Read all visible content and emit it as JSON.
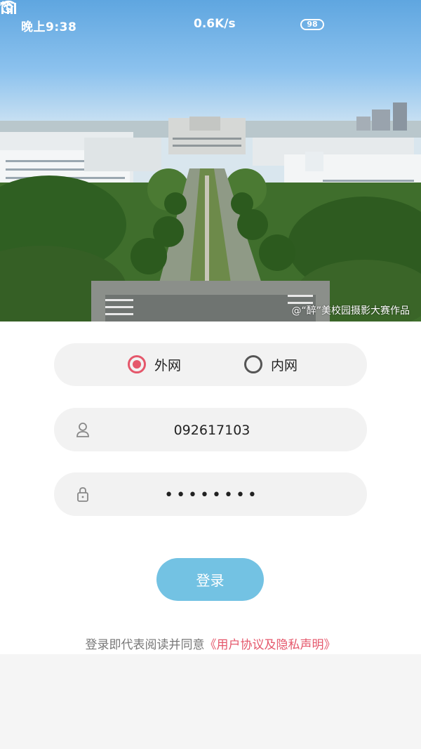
{
  "status_bar": {
    "time": "晚上9:38",
    "network_speed": "0.6K/s",
    "battery": "98"
  },
  "hero": {
    "credit": "@“醉”美校园摄影大赛作品"
  },
  "network": {
    "options": [
      {
        "label": "外网",
        "selected": true
      },
      {
        "label": "内网",
        "selected": false
      }
    ]
  },
  "form": {
    "username": "092617103",
    "password": "••••••••",
    "login_label": "登录"
  },
  "agreement": {
    "text": "登录即代表阅读并同意",
    "link": "《用户协议及隐私声明》"
  },
  "colors": {
    "accent": "#e5576b",
    "button": "#73c2e3"
  }
}
